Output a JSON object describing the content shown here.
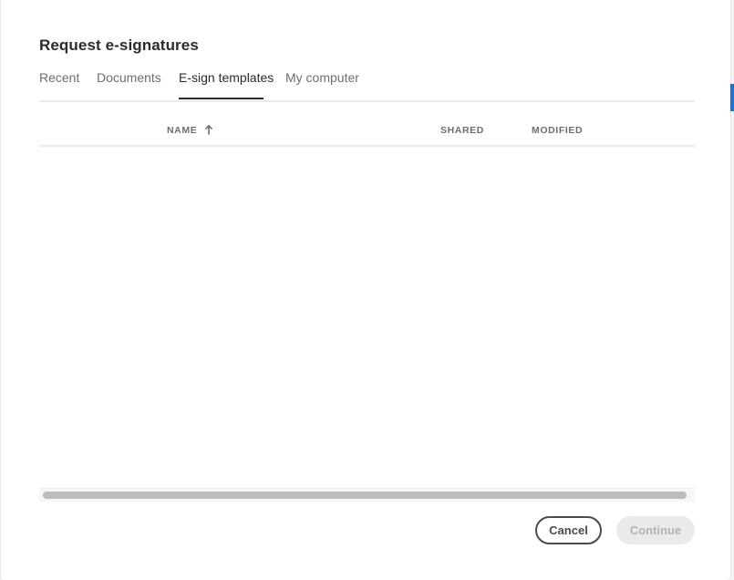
{
  "dialog": {
    "title": "Request e-signatures"
  },
  "tabs": [
    {
      "label": "Recent",
      "active": false
    },
    {
      "label": "Documents",
      "active": false
    },
    {
      "label": "E-sign templates",
      "active": true
    },
    {
      "label": "My computer",
      "active": false
    }
  ],
  "table": {
    "columns": {
      "name": "NAME",
      "shared": "SHARED",
      "modified": "MODIFIED"
    },
    "sort": {
      "column": "NAME",
      "direction": "ascending",
      "icon": "arrow-up-icon"
    },
    "rows": []
  },
  "footer": {
    "cancel_label": "Cancel",
    "continue_label": "Continue",
    "continue_enabled": false
  },
  "colors": {
    "title_text": "#2c2c2c",
    "tab_inactive": "#6e6e6e",
    "tab_active": "#2c2c2c",
    "divider": "#eaeaea",
    "button_disabled_bg": "#eaeaea",
    "button_disabled_text": "#b3b3b3",
    "scroll_thumb": "#bcbcbc",
    "accent": "#1473e6"
  }
}
